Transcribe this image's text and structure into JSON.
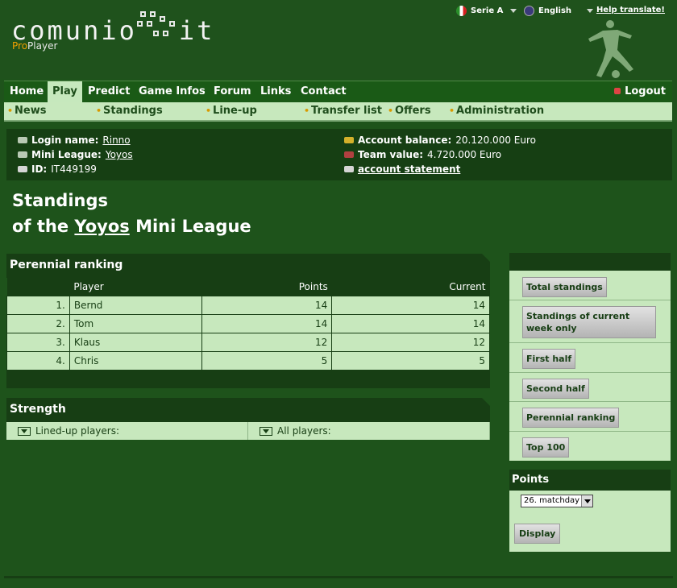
{
  "brand": {
    "logo_left": "comunio",
    "logo_right": "it",
    "pro_prefix": "Pro",
    "pro_suffix": "Player"
  },
  "lang": {
    "league": "Serie A",
    "language": "English",
    "help": "Help translate!"
  },
  "nav_top": [
    "Home",
    "Play",
    "Predict",
    "Game Infos",
    "Forum",
    "Links",
    "Contact"
  ],
  "nav_active": "Play",
  "logout": "Logout",
  "nav_sub": [
    "News",
    "Standings",
    "Line-up",
    "Transfer list",
    "Offers",
    "Administration"
  ],
  "account": {
    "login_label": "Login name:",
    "login_value": "Rinno",
    "league_label": "Mini League:",
    "league_value": "Yoyos",
    "id_label": "ID:",
    "id_value": "IT449199",
    "balance_label": "Account balance:",
    "balance_value": "20.120.000 Euro",
    "team_label": "Team value:",
    "team_value": "4.720.000 Euro",
    "statement": "account statement"
  },
  "title": {
    "line1": "Standings",
    "of_the": "of the",
    "league": "Yoyos",
    "suffix": "Mini League"
  },
  "ranking": {
    "heading": "Perennial ranking",
    "columns": {
      "player": "Player",
      "points": "Points",
      "current": "Current"
    },
    "rows": [
      {
        "rank": "1.",
        "player": "Bernd",
        "points": "14",
        "current": "14"
      },
      {
        "rank": "2.",
        "player": "Tom",
        "points": "14",
        "current": "14"
      },
      {
        "rank": "3.",
        "player": "Klaus",
        "points": "12",
        "current": "12"
      },
      {
        "rank": "4.",
        "player": "Chris",
        "points": "5",
        "current": "5"
      }
    ]
  },
  "strength": {
    "heading": "Strength",
    "lined_up": "Lined-up players:",
    "all": "All players:"
  },
  "sidebar": {
    "buttons": [
      "Total standings",
      "Standings of current week only",
      "First half",
      "Second half",
      "Perennial ranking",
      "Top 100"
    ]
  },
  "points": {
    "heading": "Points",
    "selected": "26. matchday",
    "display": "Display"
  }
}
